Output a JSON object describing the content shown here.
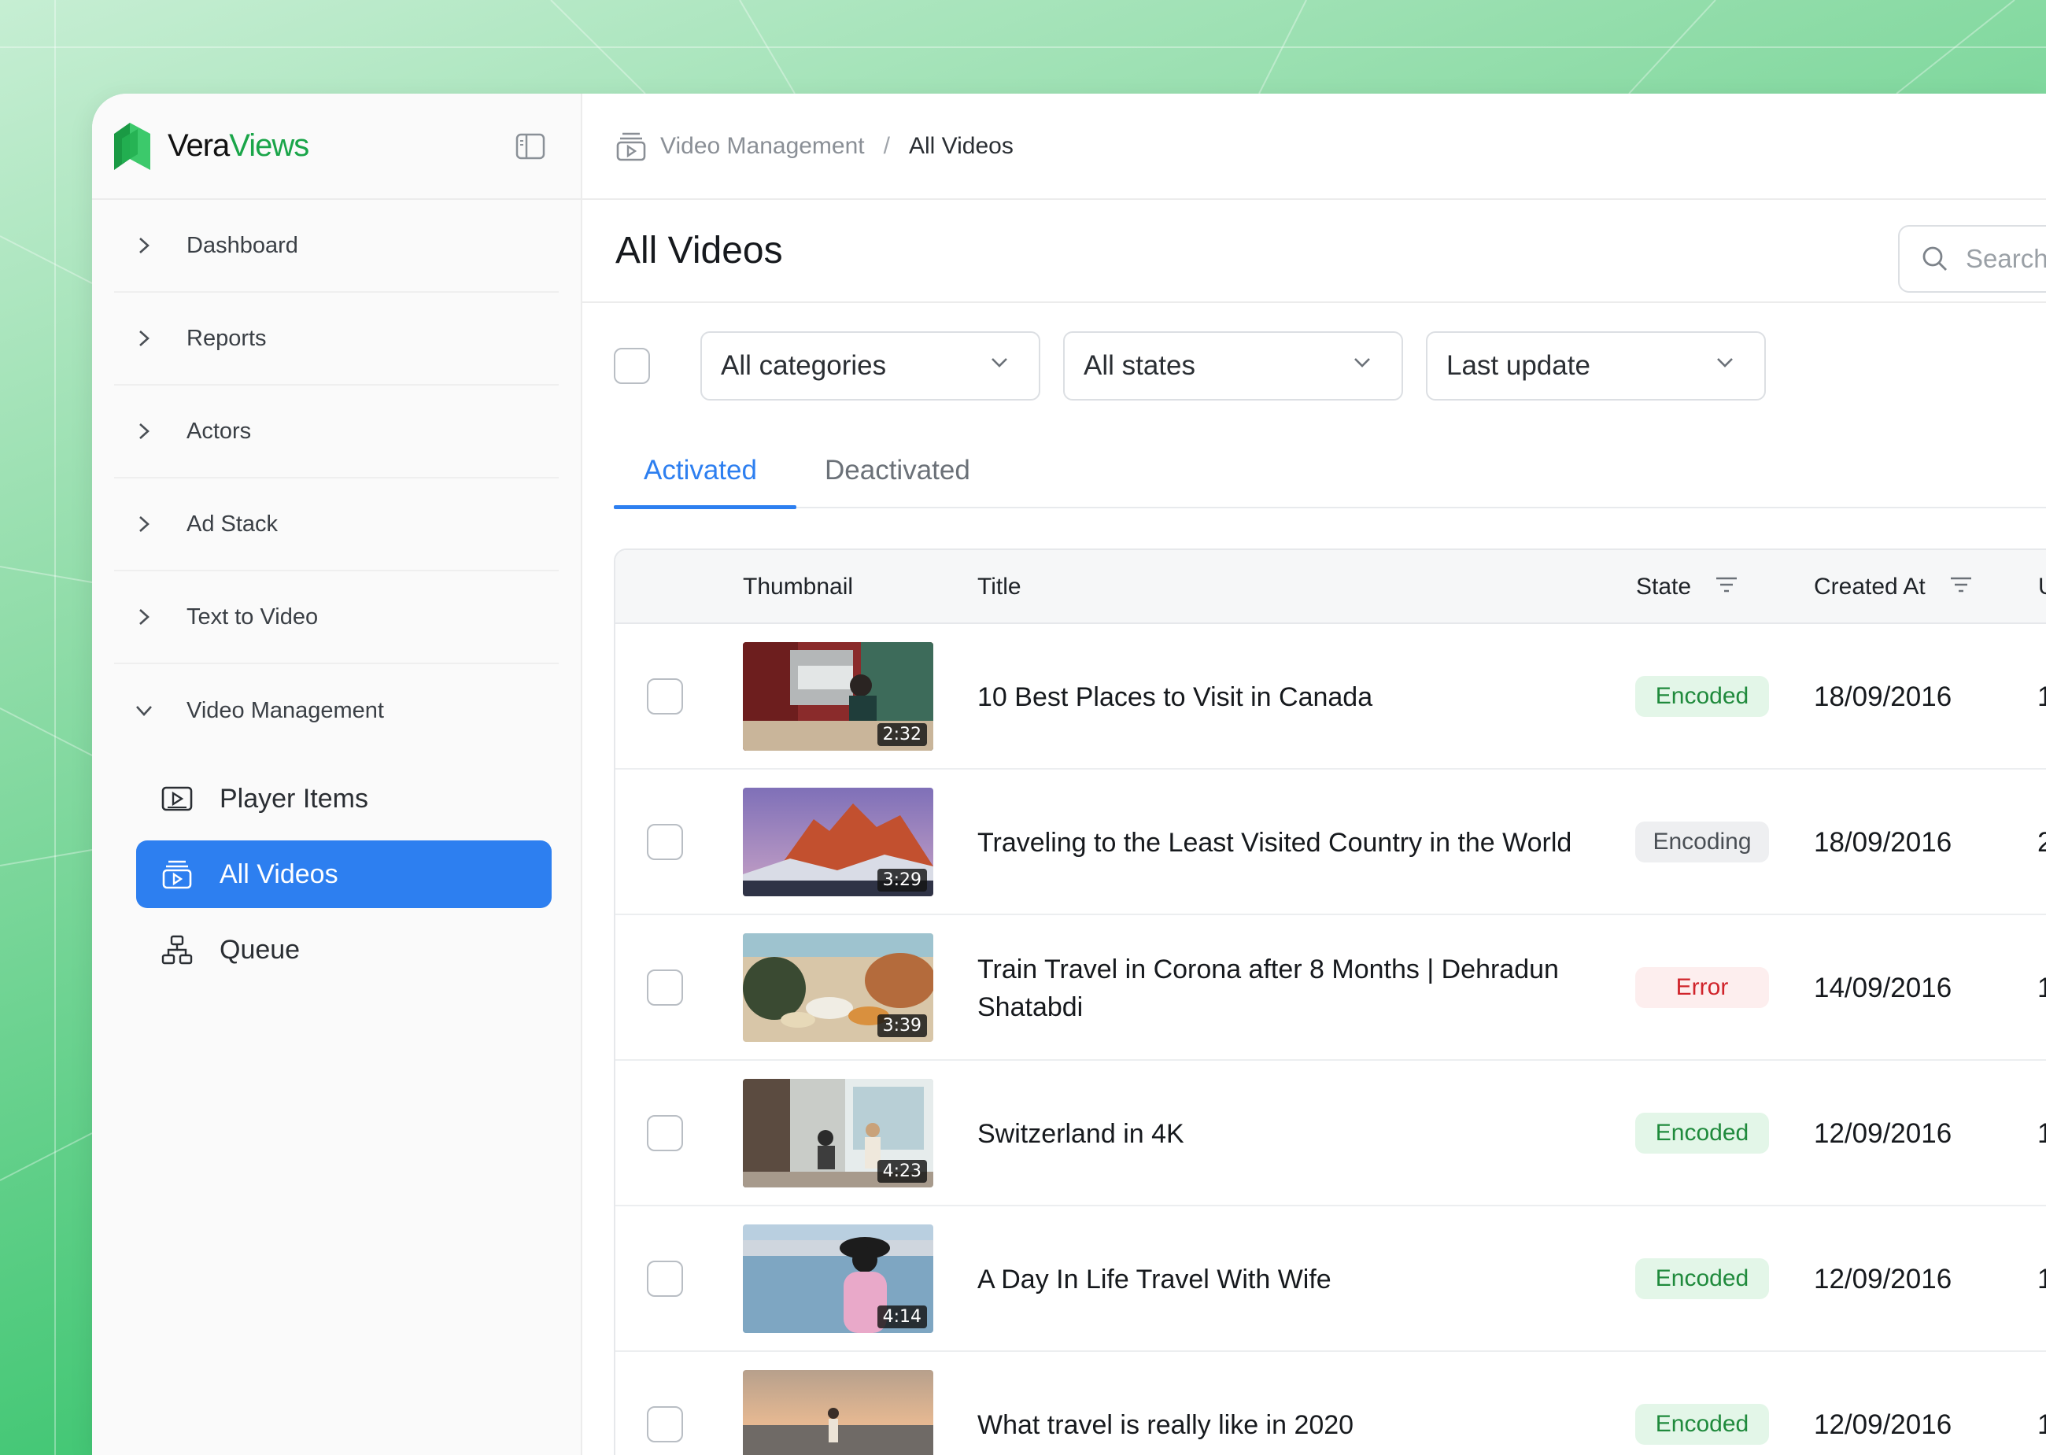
{
  "brand": {
    "name_part1": "Vera",
    "name_part2": "Views",
    "colors": {
      "logo_dark": "#1a9a44",
      "logo_light": "#3cc96b",
      "accent": "#2d7ff0"
    }
  },
  "sidebar": {
    "items": [
      {
        "label": "Dashboard",
        "icon": "chevron-right-icon"
      },
      {
        "label": "Reports",
        "icon": "chevron-right-icon"
      },
      {
        "label": "Actors",
        "icon": "chevron-right-icon"
      },
      {
        "label": "Ad Stack",
        "icon": "chevron-right-icon"
      },
      {
        "label": "Text to Video",
        "icon": "chevron-right-icon"
      },
      {
        "label": "Video Management",
        "icon": "chevron-down-icon"
      }
    ],
    "sub_items": [
      {
        "label": "Player Items",
        "icon": "player-icon"
      },
      {
        "label": "All Videos",
        "icon": "video-stack-icon",
        "active": true
      },
      {
        "label": "Queue",
        "icon": "hierarchy-icon"
      }
    ]
  },
  "breadcrumb": {
    "parent": "Video Management",
    "separator": "/",
    "current": "All Videos"
  },
  "page": {
    "title": "All Videos"
  },
  "search": {
    "placeholder": "Search"
  },
  "filters": {
    "category": "All categories",
    "state": "All states",
    "sort": "Last update"
  },
  "tabs": [
    {
      "label": "Activated",
      "active": true
    },
    {
      "label": "Deactivated",
      "active": false
    }
  ],
  "table": {
    "columns": {
      "thumbnail": "Thumbnail",
      "title": "Title",
      "state": "State",
      "created_at": "Created At",
      "updated_partial": "U"
    },
    "rows": [
      {
        "duration": "2:32",
        "title": "10 Best Places to Visit in Canada",
        "state": "Encoded",
        "created_at": "18/09/2016",
        "trail": "1"
      },
      {
        "duration": "3:29",
        "title": "Traveling to the Least Visited Country in the World",
        "state": "Encoding",
        "created_at": "18/09/2016",
        "trail": "2"
      },
      {
        "duration": "3:39",
        "title": "Train Travel in Corona after 8 Months | Dehradun Shatabdi",
        "state": "Error",
        "created_at": "14/09/2016",
        "trail": "1"
      },
      {
        "duration": "4:23",
        "title": "Switzerland in 4K",
        "state": "Encoded",
        "created_at": "12/09/2016",
        "trail": "1"
      },
      {
        "duration": "4:14",
        "title": "A Day In Life Travel With Wife",
        "state": "Encoded",
        "created_at": "12/09/2016",
        "trail": "1"
      },
      {
        "duration": "",
        "title": "What travel is really like in 2020",
        "state": "Encoded",
        "created_at": "12/09/2016",
        "trail": "1"
      }
    ]
  }
}
